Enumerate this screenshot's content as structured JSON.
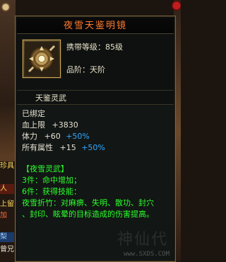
{
  "item": {
    "name": "夜雪天鉴明镜",
    "level_req": "携带等级：85级",
    "quality": "品阶：天阶",
    "subtitle": "天鉴灵武"
  },
  "stats": {
    "bound": "已绑定",
    "hp_label": "血上限",
    "hp_val": "+3830",
    "str_label": "体力",
    "str_val": "+60",
    "str_pct": "+50%",
    "all_label": "所有属性",
    "all_val": "+15",
    "all_pct": "+50%"
  },
  "set": {
    "name": "【夜雪灵武】",
    "piece3": "3件：命中增加；",
    "piece6": "6件：获得技能：",
    "skill_desc_1": "夜雪折竹：对麻痹、失明、散功、封穴",
    "skill_desc_2": "、封印、眩晕的目标造成的伤害提高。"
  },
  "chat": {
    "l1": "珍具",
    "l2": "人",
    "l3": "上留",
    "l4": "加",
    "l5": "梨",
    "l6": "曾兄"
  },
  "watermark": {
    "big": "神仙代",
    "url": "www.SXDS.COM"
  },
  "colors": {
    "title": "#ff7b2e",
    "green": "#2cff2c",
    "blue": "#33a8ff",
    "border": "#77683f"
  }
}
